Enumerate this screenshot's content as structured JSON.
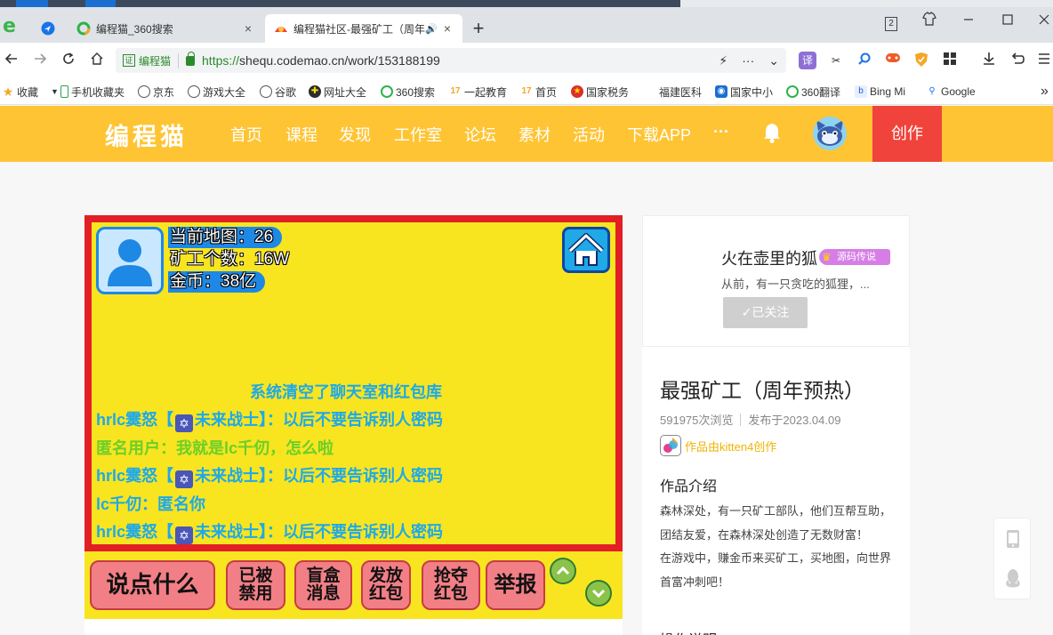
{
  "browser": {
    "tabs": [
      {
        "title": "编程猫_360搜索",
        "active": false
      },
      {
        "title": "编程猫社区-最强矿工（周年",
        "active": true
      }
    ],
    "new_tab": "+",
    "tab_close": "×",
    "window_badge": "2",
    "url": {
      "cert_label": "编程猫",
      "scheme": "https://",
      "rest": "shequ.codemao.cn/work/153188199"
    },
    "extensions": [
      "译",
      "✂",
      "🔍",
      "🎮",
      "🛡",
      "⊞"
    ],
    "bookmarks": [
      {
        "label": "收藏",
        "icon": "star"
      },
      {
        "label": "手机收藏夹",
        "icon": "phone"
      },
      {
        "label": "京东",
        "icon": "globe"
      },
      {
        "label": "游戏大全",
        "icon": "globe"
      },
      {
        "label": "谷歌",
        "icon": "globe"
      },
      {
        "label": "网址大全",
        "icon": "nav"
      },
      {
        "label": "360搜索",
        "icon": "360"
      },
      {
        "label": "一起教育",
        "icon": "17"
      },
      {
        "label": "首页",
        "icon": "17"
      },
      {
        "label": "国家税务",
        "icon": "emblem"
      },
      {
        "label": "福建医科",
        "icon": "none"
      },
      {
        "label": "国家中小",
        "icon": "school"
      },
      {
        "label": "360翻译",
        "icon": "360"
      },
      {
        "label": "Bing Mi",
        "icon": "bing"
      },
      {
        "label": "Google",
        "icon": "search"
      }
    ],
    "bookmarks_more": "»"
  },
  "site": {
    "logo": "编程猫",
    "nav": [
      "首页",
      "课程",
      "发现",
      "工作室",
      "论坛",
      "素材",
      "活动",
      "下载APP",
      "···"
    ],
    "create": "创作"
  },
  "game": {
    "stats": [
      "当前地图：26",
      "矿工个数：16W",
      "金币：38亿"
    ],
    "system_message": "系统清空了聊天室和红包库",
    "chat": [
      {
        "pre": "hrlc霙怒【",
        "badge": "✡",
        "post": "未来战士】：以后不要告诉别人密码",
        "color": "blue"
      },
      {
        "pre": "匿名用户：我就是lc千仞，怎么啦",
        "badge": "",
        "post": "",
        "color": "green"
      },
      {
        "pre": "hrlc霙怒【",
        "badge": "✡",
        "post": "未来战士】：以后不要告诉别人密码",
        "color": "blue"
      },
      {
        "pre": "lc千仞：匿名你",
        "badge": "",
        "post": "",
        "color": "blue"
      },
      {
        "pre": "hrlc霙怒【",
        "badge": "✡",
        "post": "未来战士】：以后不要告诉别人密码",
        "color": "blue"
      }
    ],
    "buttons": {
      "say": "说点什么",
      "banned": "已被\n禁用",
      "blindbox": "盲盒\n消息",
      "send_redpacket": "发放\n红包",
      "grab_redpacket": "抢夺\n红包",
      "report": "举报"
    }
  },
  "author": {
    "name": "火在壶里的狐",
    "badge": "源码传说",
    "bio": "从前，有一只贪吃的狐狸，...",
    "follow_label": "✓已关注"
  },
  "work": {
    "title": "最强矿工（周年预热）",
    "views": "591975次浏览",
    "published": "发布于2023.04.09",
    "creator": "作品由kitten4创作",
    "intro_heading": "作品介绍",
    "intro_text": "森林深处，有一只矿工部队，他们互帮互助，团结友爱，在森林深处创造了无数财富！\n在游戏中，赚金币来买矿工，买地图，向世界首富冲刺吧！",
    "ops_heading": "操作说明"
  },
  "colors": {
    "header_yellow": "#fec433",
    "create_red": "#f0433b",
    "game_red": "#e21f26",
    "game_yellow": "#f8e520",
    "chat_blue": "#1ea9e8",
    "chat_green": "#6ccf2a"
  }
}
